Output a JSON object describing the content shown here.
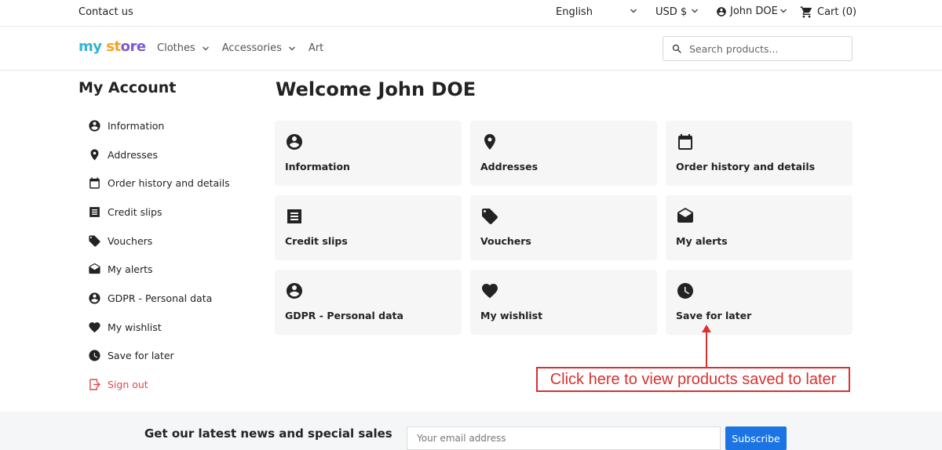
{
  "topbar": {
    "contact": "Contact us",
    "language": "English",
    "currency": "USD $",
    "user": "John DOE",
    "cart": "Cart (0)"
  },
  "header": {
    "logo_parts": [
      "my",
      " ",
      "st",
      "ore"
    ],
    "nav": [
      {
        "label": "Clothes",
        "has_dropdown": true
      },
      {
        "label": "Accessories",
        "has_dropdown": true
      },
      {
        "label": "Art",
        "has_dropdown": false
      }
    ],
    "search_placeholder": "Search products..."
  },
  "sidebar": {
    "title": "My Account",
    "items": [
      {
        "label": "Information",
        "icon": "account-circle-icon"
      },
      {
        "label": "Addresses",
        "icon": "location-pin-icon"
      },
      {
        "label": "Order history and details",
        "icon": "calendar-icon"
      },
      {
        "label": "Credit slips",
        "icon": "receipt-icon"
      },
      {
        "label": "Vouchers",
        "icon": "tag-icon"
      },
      {
        "label": "My alerts",
        "icon": "mail-open-icon"
      },
      {
        "label": "GDPR - Personal data",
        "icon": "account-circle-icon"
      },
      {
        "label": "My wishlist",
        "icon": "heart-icon"
      },
      {
        "label": "Save for later",
        "icon": "clock-icon"
      },
      {
        "label": "Sign out",
        "icon": "logout-icon"
      }
    ]
  },
  "main": {
    "title": "Welcome John DOE",
    "tiles": [
      {
        "label": "Information",
        "icon": "account-circle-icon"
      },
      {
        "label": "Addresses",
        "icon": "location-pin-icon"
      },
      {
        "label": "Order history and details",
        "icon": "calendar-icon"
      },
      {
        "label": "Credit slips",
        "icon": "receipt-icon"
      },
      {
        "label": "Vouchers",
        "icon": "tag-icon"
      },
      {
        "label": "My alerts",
        "icon": "mail-open-icon"
      },
      {
        "label": "GDPR - Personal data",
        "icon": "account-circle-icon"
      },
      {
        "label": "My wishlist",
        "icon": "heart-icon"
      },
      {
        "label": "Save for later",
        "icon": "clock-icon"
      }
    ]
  },
  "annotation": {
    "text": "Click here to view products saved to later",
    "color": "#d93030"
  },
  "newsletter": {
    "title": "Get our latest news and special sales",
    "email_placeholder": "Your email address",
    "subscribe_label": "Subscribe",
    "button_color": "#1b74e4"
  }
}
